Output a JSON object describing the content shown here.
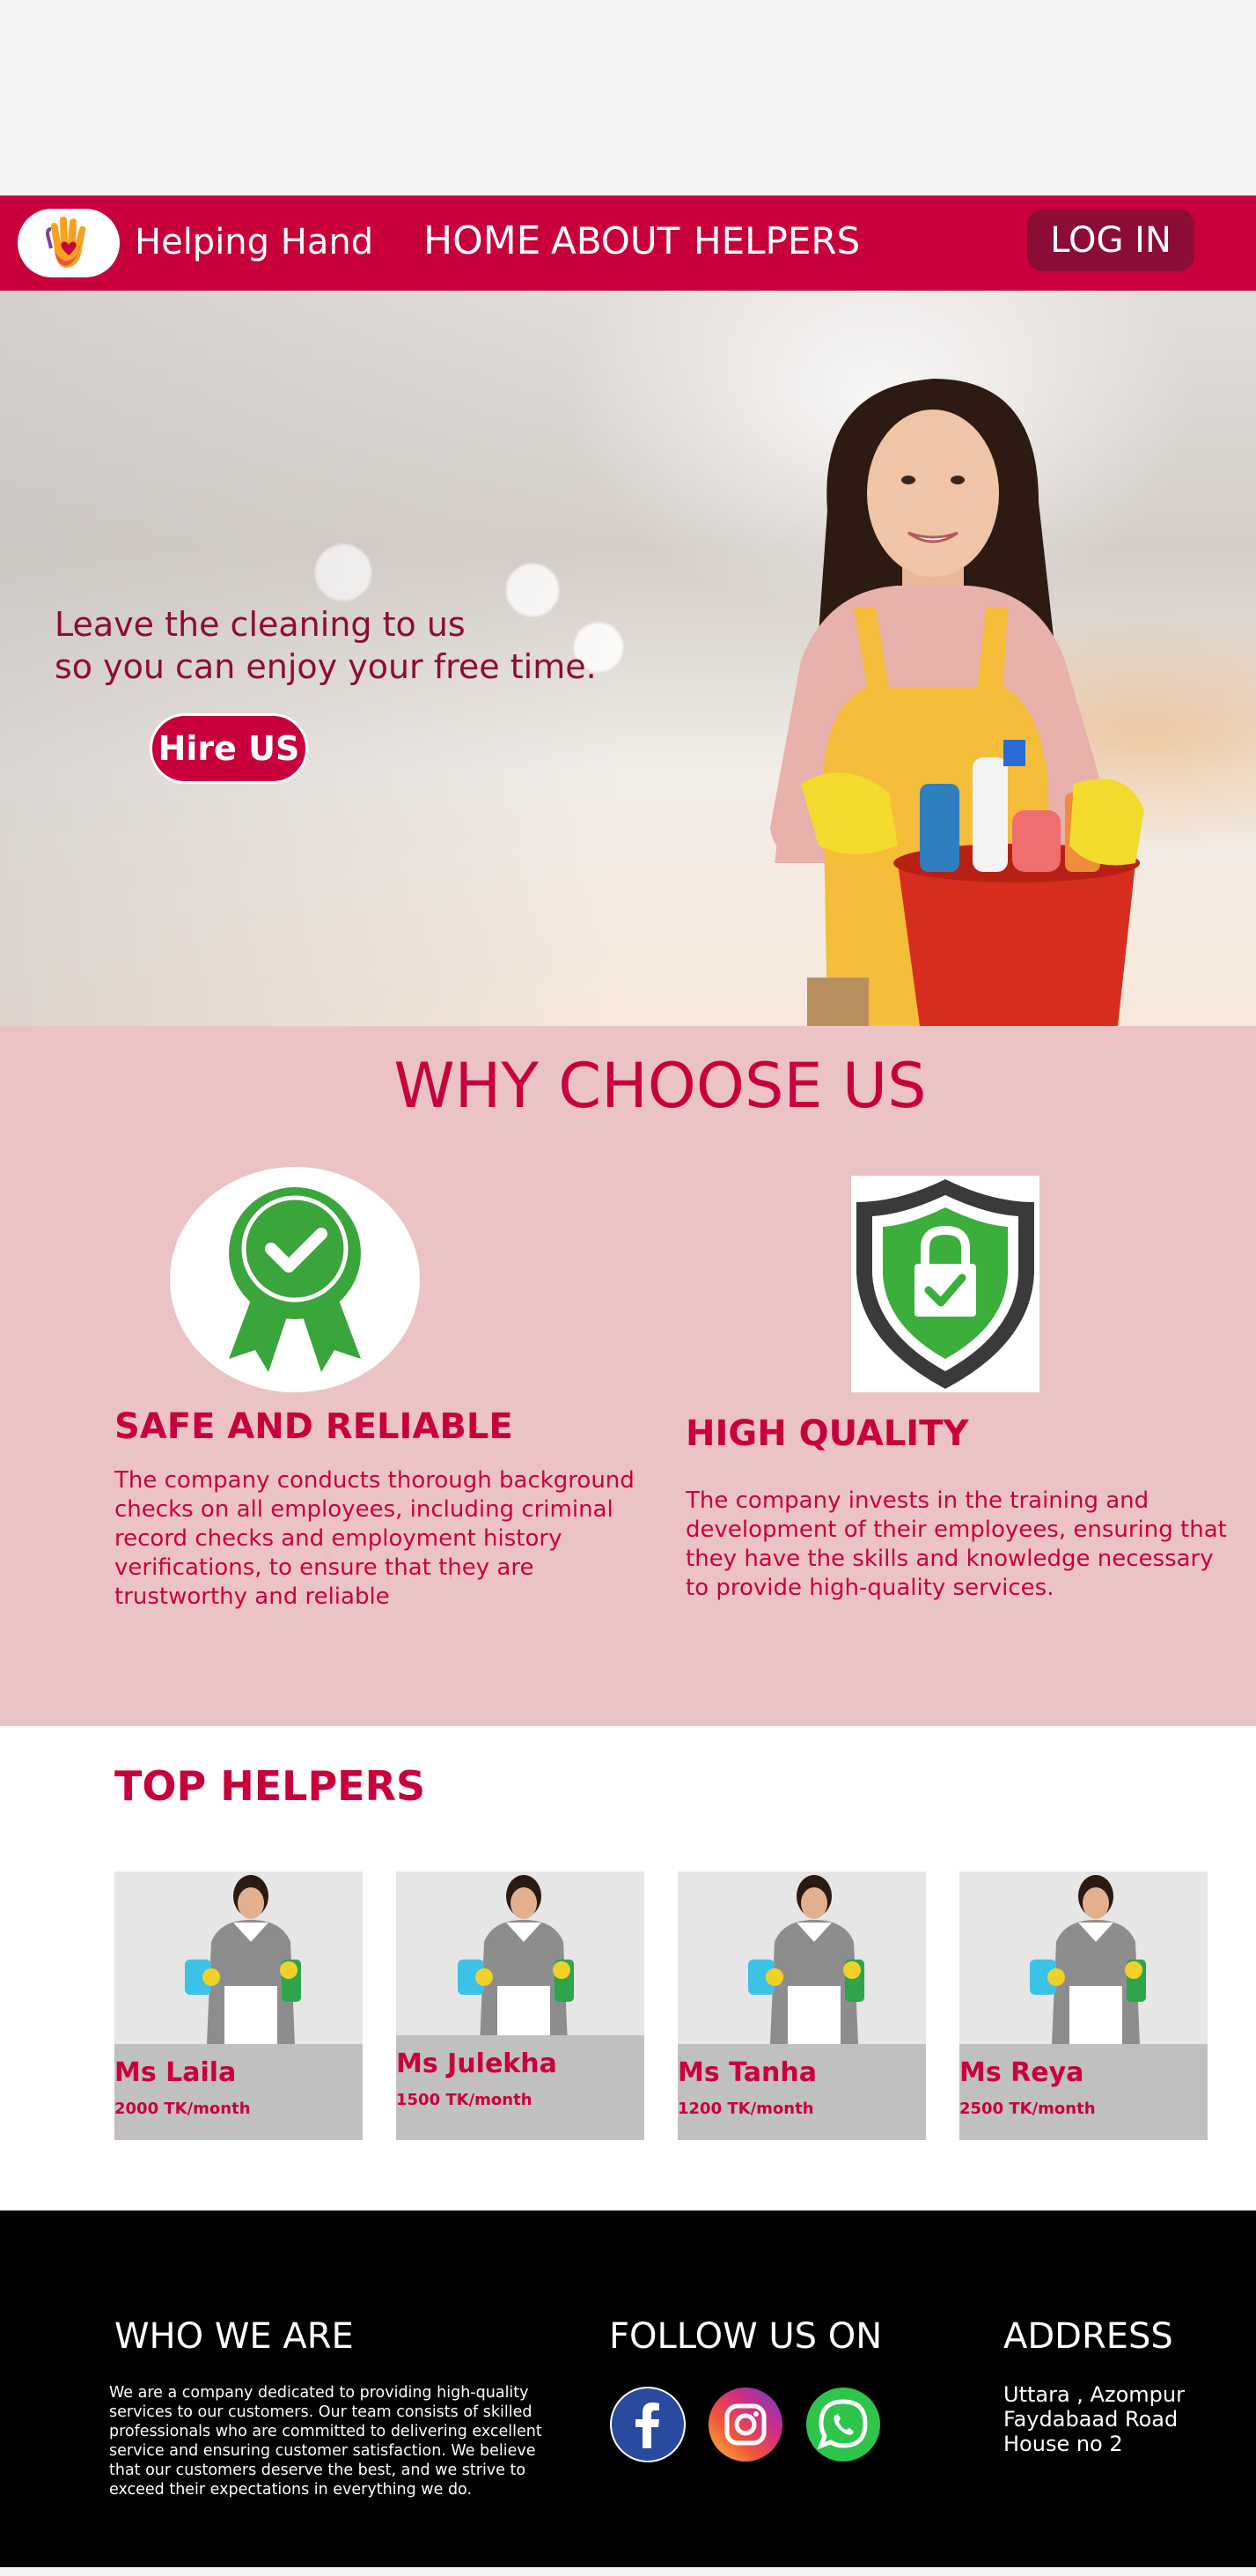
{
  "navbar": {
    "brand": "Helping Hand",
    "links": [
      "HOME",
      "ABOUT",
      "HELPERS"
    ],
    "login": "LOG IN"
  },
  "hero": {
    "line1": "Leave the cleaning to us",
    "line2": "so you can enjoy your free time.",
    "cta": "Hire US"
  },
  "why": {
    "title": "WHY CHOOSE US",
    "features": [
      {
        "title": "SAFE AND RELIABLE",
        "lines": [
          "The company conducts thorough background",
          "checks on all employees, including criminal",
          "record checks and employment history",
          "verifications, to ensure that they are",
          "trustworthy and reliable"
        ]
      },
      {
        "title": "HIGH QUALITY",
        "lines": [
          "The company invests in the training and",
          "development of their employees, ensuring that",
          "they have the skills and knowledge necessary",
          "to provide high-quality services."
        ]
      }
    ]
  },
  "helpers": {
    "title": "TOP HELPERS",
    "items": [
      {
        "name": "Ms Laila",
        "price": "2000 TK/month"
      },
      {
        "name": "Ms Julekha",
        "price": "1500 TK/month"
      },
      {
        "name": "Ms Tanha",
        "price": "1200 TK/month"
      },
      {
        "name": "Ms Reya",
        "price": "2500 TK/month"
      }
    ]
  },
  "footer": {
    "who_title": "WHO WE ARE",
    "who_lines": [
      "We are a company dedicated to providing high-quality",
      "services to our customers. Our team consists of skilled",
      "professionals who are committed to delivering excellent",
      "service and ensuring customer satisfaction. We believe",
      "that our customers deserve the best, and we strive to",
      "exceed their expectations in everything we do."
    ],
    "follow_title": "FOLLOW US ON",
    "social_icons": [
      "facebook-icon",
      "instagram-icon",
      "whatsapp-icon"
    ],
    "address_title": "ADDRESS",
    "address_lines": [
      "Uttara , Azompur",
      "Faydabaad Road",
      "House  no 2"
    ]
  },
  "colors": {
    "brand": "#c8003b",
    "login_bg": "#8b0d35",
    "why_bg": "#ecc3c5",
    "card_info_bg": "#c0c0c0",
    "footer_bg": "#000000"
  }
}
